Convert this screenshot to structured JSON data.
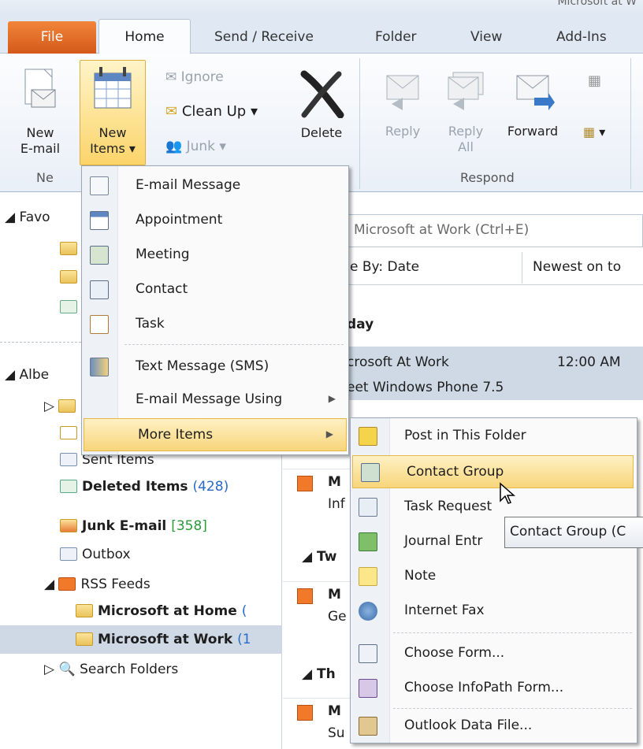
{
  "window": {
    "title": "Microsoft at W"
  },
  "tabs": [
    {
      "label": "File"
    },
    {
      "label": "Home"
    },
    {
      "label": "Send / Receive"
    },
    {
      "label": "Folder"
    },
    {
      "label": "View"
    },
    {
      "label": "Add-Ins"
    }
  ],
  "ribbon": {
    "new_email": [
      "New",
      "E-mail"
    ],
    "new_items": [
      "New",
      "Items ▾"
    ],
    "ignore": "Ignore",
    "clean_up": "Clean Up ▾",
    "junk": "Junk ▾",
    "delete": "Delete",
    "reply": "Reply",
    "reply_all": [
      "Reply",
      "All"
    ],
    "forward": "Forward",
    "group_new": "Ne",
    "group_respond": "Respond"
  },
  "nav": {
    "favorites": "Favo",
    "account": "Albe",
    "sent": "Sent Items",
    "deleted": "Deleted Items",
    "deleted_count": "(428)",
    "junk": "Junk E-mail",
    "junk_count": "[358]",
    "outbox": "Outbox",
    "rss": "RSS Feeds",
    "ms_home": "Microsoft at Home",
    "ms_home_count": "(",
    "ms_work": "Microsoft at Work",
    "ms_work_count": "(1",
    "search_folders": "Search Folders"
  },
  "main": {
    "search_placeholder": "Microsoft at Work (Ctrl+E)",
    "arrange_by": "e By: Date",
    "sort_order": "Newest on to",
    "group_today": "day",
    "sel_from": "crosoft At Work",
    "sel_time": "12:00 AM",
    "sel_subject": "eet Windows Phone 7.5",
    "row1_a": "M",
    "row1_b": "Inf",
    "group_two": "Tw",
    "row2_a": "M",
    "row2_b": "Ge",
    "group_three": "Th",
    "row3_a": "M",
    "row3_b": "Su"
  },
  "menu_new_items": [
    {
      "label": "E-mail Message",
      "icon": "email-message-icon"
    },
    {
      "label": "Appointment",
      "icon": "calendar-icon"
    },
    {
      "label": "Meeting",
      "icon": "meeting-icon"
    },
    {
      "label": "Contact",
      "icon": "contact-card-icon"
    },
    {
      "label": "Task",
      "icon": "task-clipboard-icon"
    },
    {
      "label": "Text Message (SMS)",
      "icon": "sms-phone-icon"
    },
    {
      "label": "E-mail Message Using",
      "icon": ""
    },
    {
      "label": "More Items",
      "icon": ""
    }
  ],
  "menu_more_items": [
    {
      "label": "Post in This Folder",
      "icon": "post-icon"
    },
    {
      "label": "Contact Group",
      "icon": "contact-group-icon"
    },
    {
      "label": "Task Request",
      "icon": "task-request-icon"
    },
    {
      "label": "Journal Entr",
      "icon": "journal-icon"
    },
    {
      "label": "Note",
      "icon": "note-icon"
    },
    {
      "label": "Internet Fax",
      "icon": "fax-icon"
    },
    {
      "label": "Choose Form...",
      "icon": "form-icon"
    },
    {
      "label": "Choose InfoPath Form...",
      "icon": "infopath-icon"
    },
    {
      "label": "Outlook Data File...",
      "icon": "data-file-icon"
    }
  ],
  "tooltip": "Contact Group (C",
  "colors": {
    "file_tab": "#e06a22",
    "highlight": "#f7d57a",
    "selection": "#cfd9e5"
  }
}
